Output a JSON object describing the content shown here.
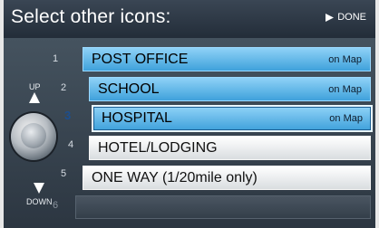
{
  "header": {
    "title": "Select other icons:",
    "done_label": "DONE"
  },
  "side": {
    "up_label": "UP",
    "down_label": "DOWN",
    "numbers": [
      "1",
      "2",
      "3",
      "4",
      "5",
      "6"
    ]
  },
  "list": {
    "items": [
      {
        "label": "POST OFFICE",
        "tag": "on Map"
      },
      {
        "label": "SCHOOL",
        "tag": "on Map"
      },
      {
        "label": "HOSPITAL",
        "tag": "on Map"
      },
      {
        "label": "HOTEL/LODGING",
        "tag": ""
      },
      {
        "label": "ONE WAY (1/20mile only)",
        "tag": ""
      }
    ],
    "selected_index": 2
  },
  "colors": {
    "selected_blue": "#3fa1db",
    "background": "#1f2833"
  },
  "icons": [
    "play-arrow-icon",
    "up-arrow-icon",
    "down-arrow-icon",
    "selector-knob-icon"
  ]
}
